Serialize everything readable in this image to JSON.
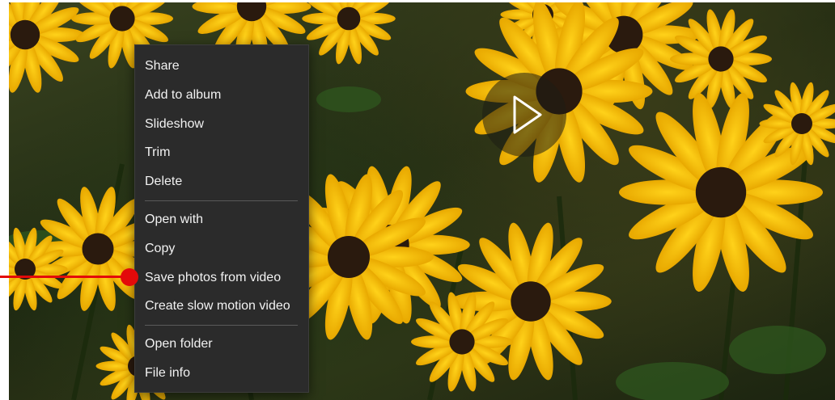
{
  "context_menu": {
    "items": [
      {
        "label": "Share"
      },
      {
        "label": "Add to album"
      },
      {
        "label": "Slideshow"
      },
      {
        "label": "Trim"
      },
      {
        "label": "Delete"
      },
      {
        "label": "Open with"
      },
      {
        "label": "Copy"
      },
      {
        "label": "Save photos from video"
      },
      {
        "label": "Create slow motion video"
      },
      {
        "label": "Open folder"
      },
      {
        "label": "File info"
      }
    ]
  },
  "annotation": {
    "color": "#e30a0a"
  },
  "icons": {
    "play": "play-icon"
  }
}
